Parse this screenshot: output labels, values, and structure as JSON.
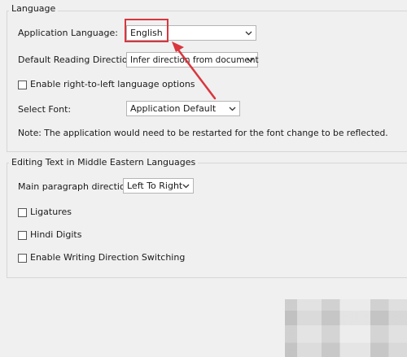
{
  "language": {
    "legend": "Language",
    "app_language_label": "Application Language:",
    "app_language_value": "English",
    "reading_direction_label": "Default Reading Direction:",
    "reading_direction_value": "Infer direction from document",
    "rtl_checkbox_label": "Enable right-to-left language options",
    "rtl_checked": false,
    "select_font_label": "Select Font:",
    "select_font_value": "Application Default",
    "note": "Note: The application would need to be restarted for the font change to be reflected."
  },
  "middle_east": {
    "legend": "Editing Text in Middle Eastern Languages",
    "paragraph_direction_label": "Main paragraph direction:",
    "paragraph_direction_value": "Left To Right",
    "ligatures_label": "Ligatures",
    "ligatures_checked": false,
    "hindi_digits_label": "Hindi Digits",
    "hindi_digits_checked": false,
    "writing_direction_label": "Enable Writing Direction Switching",
    "writing_direction_checked": false
  },
  "colors": {
    "highlight": "#d9363e",
    "background": "#f0f0f0"
  },
  "icons": {
    "dropdown": "chevron-down-icon",
    "annotation": "red-arrow-annotation"
  }
}
